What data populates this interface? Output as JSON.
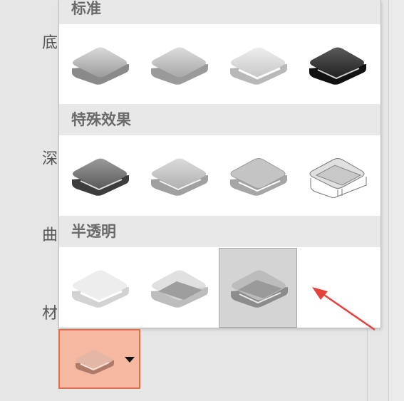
{
  "side_labels": [
    "底",
    "深",
    "曲",
    "材"
  ],
  "menu": {
    "sections": [
      {
        "title": "标准",
        "items": [
          "matte",
          "warm-matte",
          "plastic",
          "metal"
        ]
      },
      {
        "title": "特殊效果",
        "items": [
          "dark-edge",
          "soft-edge",
          "flat",
          "wireframe"
        ]
      },
      {
        "title": "半透明",
        "items": [
          "powder",
          "clear",
          "translucent-powder"
        ]
      }
    ],
    "selected_item": "translucent-powder"
  },
  "material_button": {
    "icon": "material-preview-icon",
    "dropdown_icon": "caret-down-icon"
  },
  "colors": {
    "accent_fill": "#f4b9a0",
    "accent_border": "#e0704d",
    "selected_tile": "#d4d4d4",
    "annotation_arrow": "#e8413a"
  }
}
